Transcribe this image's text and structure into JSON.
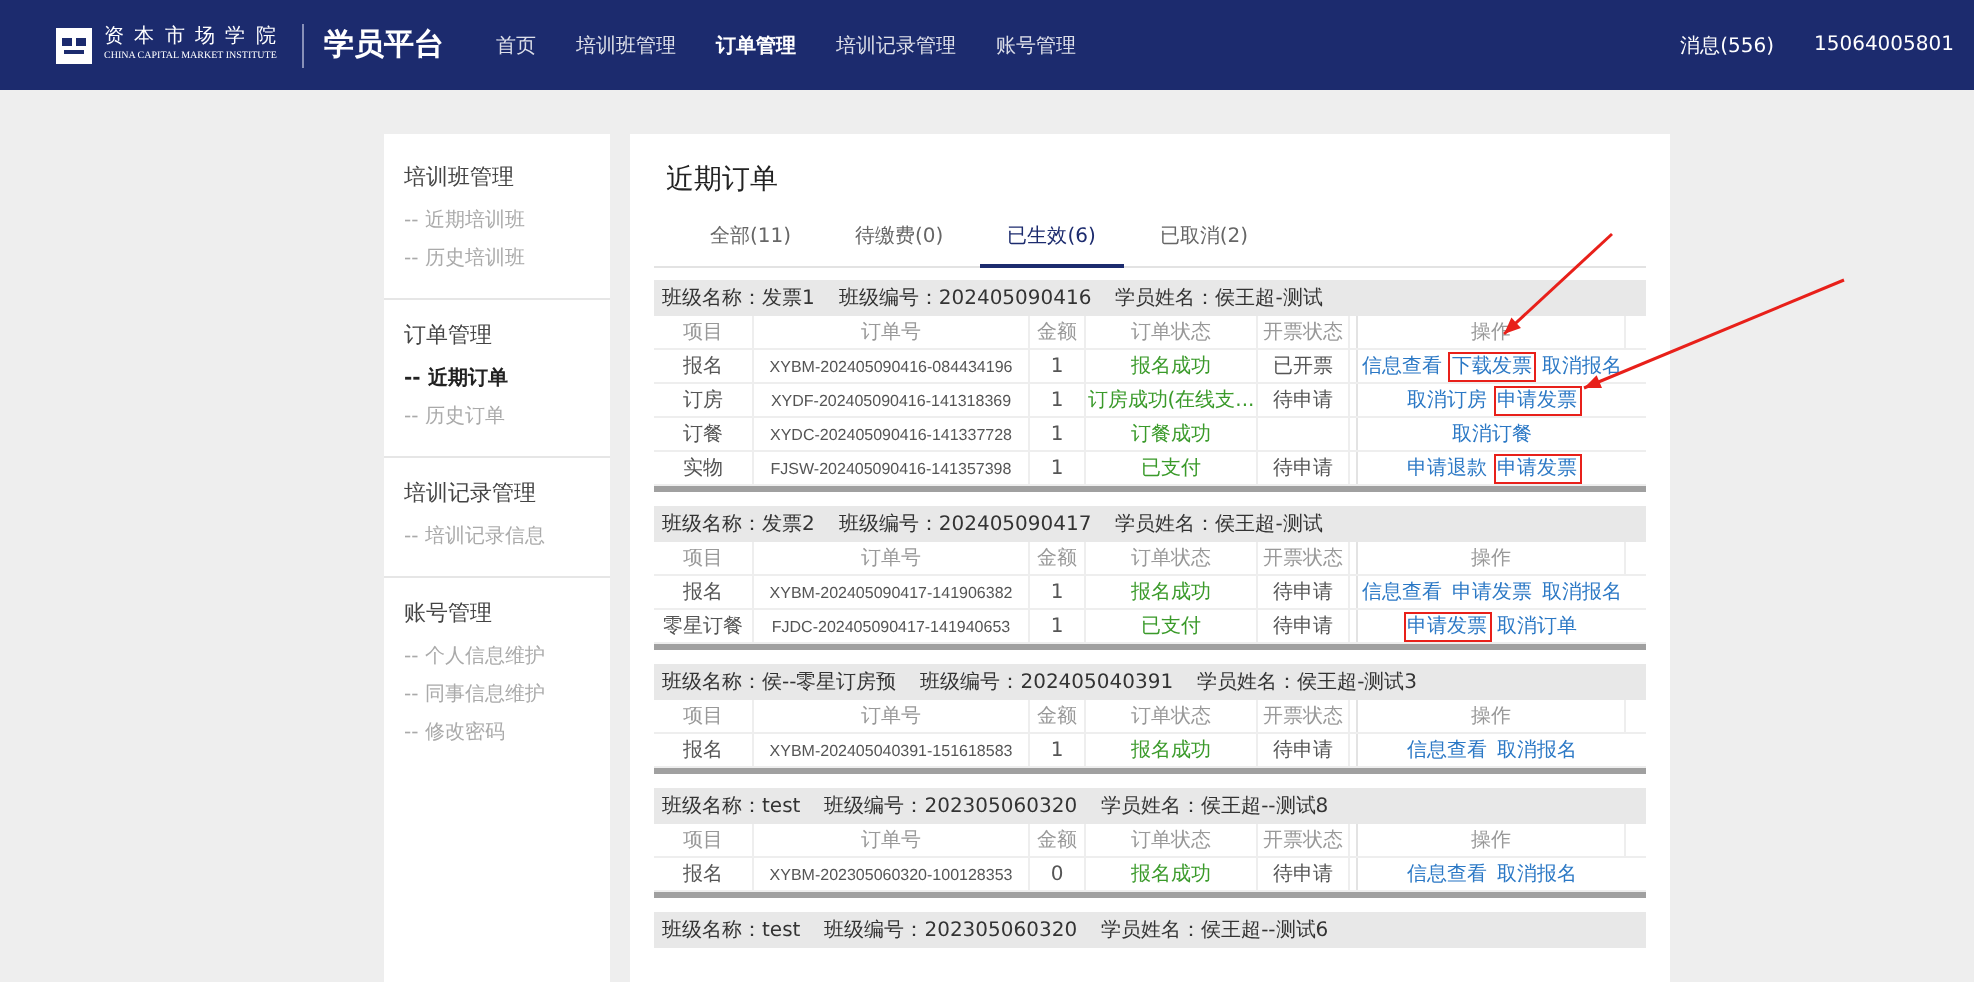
{
  "header": {
    "logo_name": "资 本 市 场 学 院",
    "logo_subtitle": "CHINA CAPITAL MARKET INSTITUTE",
    "platform_title": "学员平台",
    "nav": [
      {
        "label": "首页",
        "selected": false
      },
      {
        "label": "培训班管理",
        "selected": false
      },
      {
        "label": "订单管理",
        "selected": true
      },
      {
        "label": "培训记录管理",
        "selected": false
      },
      {
        "label": "账号管理",
        "selected": false
      }
    ],
    "messages": "消息(556)",
    "user": "15064005801"
  },
  "sidebar": {
    "sections": [
      {
        "title": "培训班管理",
        "items": [
          {
            "label": "-- 近期培训班",
            "selected": false
          },
          {
            "label": "-- 历史培训班",
            "selected": false
          }
        ]
      },
      {
        "title": "订单管理",
        "items": [
          {
            "label": "-- 近期订单",
            "selected": true
          },
          {
            "label": "-- 历史订单",
            "selected": false
          }
        ]
      },
      {
        "title": "培训记录管理",
        "items": [
          {
            "label": "-- 培训记录信息",
            "selected": false
          }
        ]
      },
      {
        "title": "账号管理",
        "items": [
          {
            "label": "-- 个人信息维护",
            "selected": false
          },
          {
            "label": "-- 同事信息维护",
            "selected": false
          },
          {
            "label": "-- 修改密码",
            "selected": false
          }
        ]
      }
    ]
  },
  "main": {
    "title": "近期订单",
    "tabs": [
      {
        "label": "全部(11)",
        "selected": false
      },
      {
        "label": "待缴费(0)",
        "selected": false
      },
      {
        "label": "已生效(6)",
        "selected": true
      },
      {
        "label": "已取消(2)",
        "selected": false
      }
    ],
    "groups": [
      {
        "class_name": "班级名称：发票1",
        "class_code": "班级编号：202405090416",
        "student": "学员姓名：侯王超-测试",
        "columns": [
          "项目",
          "订单号",
          "金额",
          "订单状态",
          "开票状态",
          "操作"
        ],
        "rows": [
          {
            "item": "报名",
            "order_no": "XYBM-202405090416-084434196",
            "amount": "1",
            "order_status": "报名成功",
            "invoice_status": "已开票",
            "actions": [
              {
                "label": "信息查看",
                "highlighted": false
              },
              {
                "label": "下载发票",
                "highlighted": true
              },
              {
                "label": "取消报名",
                "highlighted": false
              }
            ]
          },
          {
            "item": "订房",
            "order_no": "XYDF-202405090416-141318369",
            "amount": "1",
            "order_status": "订房成功(在线支...",
            "invoice_status": "待申请",
            "actions": [
              {
                "label": "取消订房",
                "highlighted": false
              },
              {
                "label": "申请发票",
                "highlighted": true
              }
            ]
          },
          {
            "item": "订餐",
            "order_no": "XYDC-202405090416-141337728",
            "amount": "1",
            "order_status": "订餐成功",
            "actions": [
              {
                "label": "取消订餐",
                "highlighted": false
              }
            ]
          },
          {
            "item": "实物",
            "order_no": "FJSW-202405090416-141357398",
            "amount": "1",
            "order_status": "已支付",
            "invoice_status": "待申请",
            "actions": [
              {
                "label": "申请退款",
                "highlighted": false
              },
              {
                "label": "申请发票",
                "highlighted": true
              }
            ]
          }
        ]
      },
      {
        "class_name": "班级名称：发票2",
        "class_code": "班级编号：202405090417",
        "student": "学员姓名：侯王超-测试",
        "columns": [
          "项目",
          "订单号",
          "金额",
          "订单状态",
          "开票状态",
          "操作"
        ],
        "rows": [
          {
            "item": "报名",
            "order_no": "XYBM-202405090417-141906382",
            "amount": "1",
            "order_status": "报名成功",
            "invoice_status": "待申请",
            "actions": [
              {
                "label": "信息查看",
                "highlighted": false
              },
              {
                "label": "申请发票",
                "highlighted": false
              },
              {
                "label": "取消报名",
                "highlighted": false
              }
            ]
          },
          {
            "item": "零星订餐",
            "order_no": "FJDC-202405090417-141940653",
            "amount": "1",
            "order_status": "已支付",
            "invoice_status": "待申请",
            "actions": [
              {
                "label": "申请发票",
                "highlighted": true
              },
              {
                "label": "取消订单",
                "highlighted": false
              }
            ]
          }
        ]
      },
      {
        "class_name": "班级名称：侯--零星订房预",
        "class_code": "班级编号：202405040391",
        "student": "学员姓名：侯王超-测试3",
        "columns": [
          "项目",
          "订单号",
          "金额",
          "订单状态",
          "开票状态",
          "操作"
        ],
        "rows": [
          {
            "item": "报名",
            "order_no": "XYBM-202405040391-151618583",
            "amount": "1",
            "order_status": "报名成功",
            "invoice_status": "待申请",
            "actions": [
              {
                "label": "信息查看",
                "highlighted": false
              },
              {
                "label": "取消报名",
                "highlighted": false
              }
            ]
          }
        ]
      },
      {
        "class_name": "班级名称：test",
        "class_code": "班级编号：202305060320",
        "student": "学员姓名：侯王超--测试8",
        "columns": [
          "项目",
          "订单号",
          "金额",
          "订单状态",
          "开票状态",
          "操作"
        ],
        "rows": [
          {
            "item": "报名",
            "order_no": "XYBM-202305060320-100128353",
            "amount": "0",
            "order_status": "报名成功",
            "invoice_status": "待申请",
            "actions": [
              {
                "label": "信息查看",
                "highlighted": false
              },
              {
                "label": "取消报名",
                "highlighted": false
              }
            ]
          }
        ]
      },
      {
        "class_name": "班级名称：test",
        "class_code": "班级编号：202305060320",
        "student": "学员姓名：侯王超--测试6"
      }
    ]
  },
  "annotations": [
    {
      "kind": "arrow"
    },
    {
      "kind": "arrow"
    }
  ]
}
